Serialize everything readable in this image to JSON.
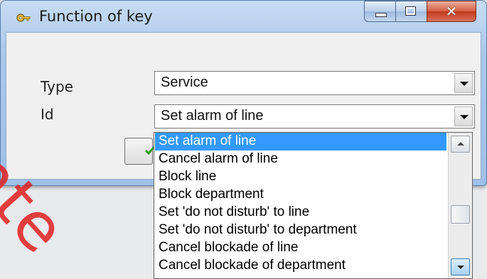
{
  "window": {
    "title": "Function of key",
    "app_icon": "key-icon"
  },
  "form": {
    "type_label": "Type",
    "type_value": "Service",
    "id_label": "Id",
    "id_value": "Set alarm of line"
  },
  "dropdown": {
    "items": [
      "Set alarm of line",
      "Cancel alarm of line",
      "Block line",
      "Block department",
      "Set 'do not disturb' to line",
      "Set 'do not disturb' to department",
      "Cancel blockade of line",
      "Cancel blockade of department"
    ],
    "selected_index": 0
  },
  "watermark": "Inte",
  "colors": {
    "selection": "#3399ff",
    "watermark": "#e02020"
  }
}
